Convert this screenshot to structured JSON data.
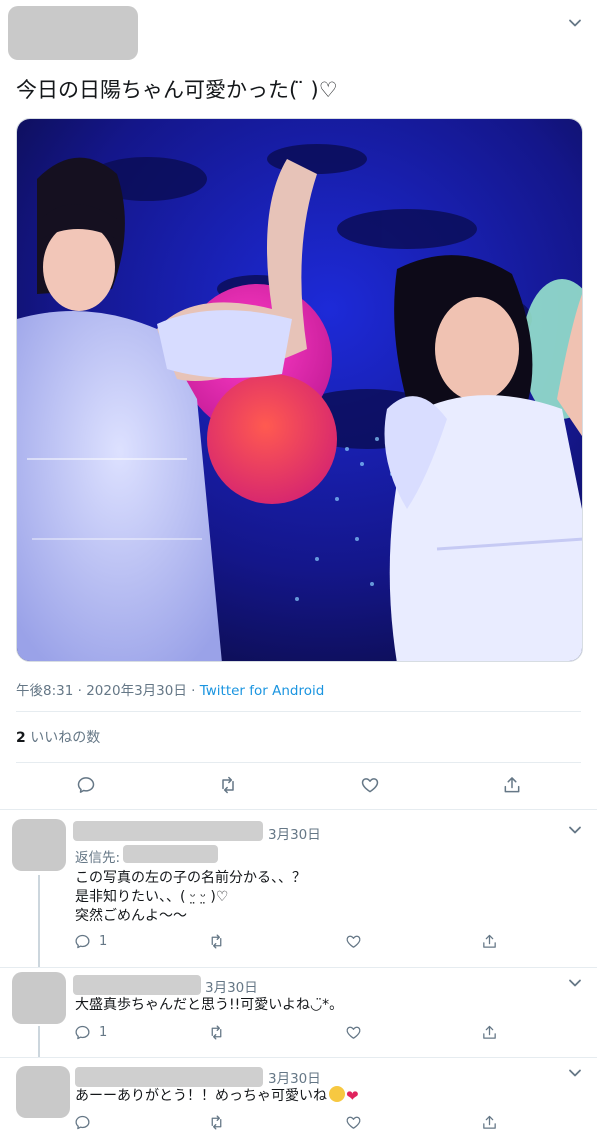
{
  "main_tweet": {
    "text": "今日の日陽ちゃん可愛かった(  ̈ )♡",
    "time": "午後8:31",
    "dot": "·",
    "date": "2020年3月30日",
    "source": "Twitter for Android",
    "likes_count": "2",
    "likes_label": " いいねの数"
  },
  "replies": [
    {
      "date": "3月30日",
      "reply_to_label": "返信先:",
      "lines": [
        "この写真の左の子の名前分かる、、？",
        "是非知りたい、、( ᵕ̤ ᵕ̤ )♡",
        "突然ごめんよ〜〜"
      ],
      "reply_count": "1"
    },
    {
      "date": "3月30日",
      "lines": [
        "大盛真歩ちゃんだと思う!!可愛いよね◡̈*。"
      ],
      "reply_count": "1"
    },
    {
      "date": "3月30日",
      "lines": [
        "あーーありがとう！！めっちゃ可愛いね"
      ],
      "reply_count": ""
    }
  ],
  "icons": {
    "reply": "reply-icon",
    "retweet": "retweet-icon",
    "like": "heart-icon",
    "share": "share-icon",
    "chevron": "chevron-down-icon"
  }
}
